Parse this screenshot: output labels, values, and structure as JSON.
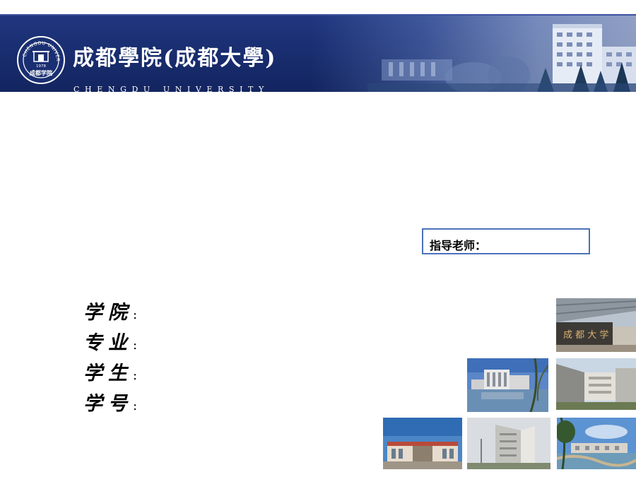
{
  "banner": {
    "title": "成都學院(成都大學)",
    "subtitle": "CHENGDU UNIVERSITY",
    "seal_text": "CHENGDU UNIVERSITY",
    "seal_year": "1978",
    "seal_cn": "成都学院",
    "colors": {
      "banner": "#1a2f72",
      "accent": "#4a72b8"
    }
  },
  "advisor": {
    "label": "指导老师："
  },
  "fields": [
    {
      "label": "学院",
      "colon": ":"
    },
    {
      "label": "专业",
      "colon": ":"
    },
    {
      "label": "学生",
      "colon": ":"
    },
    {
      "label": "学号",
      "colon": ":"
    }
  ],
  "photos": [
    {
      "name": "campus-gate-photo",
      "caption": "成 都 大 学"
    },
    {
      "name": "campus-lake-building-photo"
    },
    {
      "name": "campus-plaza-photo"
    },
    {
      "name": "campus-library-photo"
    },
    {
      "name": "campus-tall-building-photo"
    },
    {
      "name": "campus-riverside-photo"
    }
  ]
}
